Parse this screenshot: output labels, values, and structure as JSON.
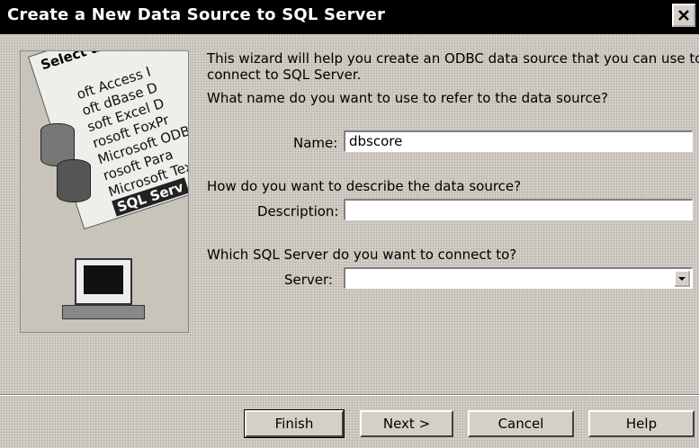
{
  "window": {
    "title": "Create a New Data Source to SQL Server"
  },
  "wizard_art": {
    "banner": "Select a driver for",
    "drivers": [
      "oft Access I",
      "oft dBase D",
      "soft Excel D",
      "rosoft FoxPr",
      "Microsoft ODBC",
      "rosoft Para",
      "Microsoft Tex",
      "SQL Serv"
    ]
  },
  "intro": {
    "line1": "This wizard will help you create an ODBC data source that you can use to",
    "line2": "connect to SQL Server.",
    "name_question": "What name do you want to use to refer to the data source?"
  },
  "name_field": {
    "label": "Name:",
    "value": "dbscore"
  },
  "description": {
    "question": "How do you want to describe the data source?",
    "label": "Description:",
    "value": ""
  },
  "server": {
    "question": "Which SQL Server do you want to connect to?",
    "label": "Server:",
    "value": ""
  },
  "buttons": {
    "finish": "Finish",
    "next": "Next >",
    "cancel": "Cancel",
    "help": "Help"
  }
}
